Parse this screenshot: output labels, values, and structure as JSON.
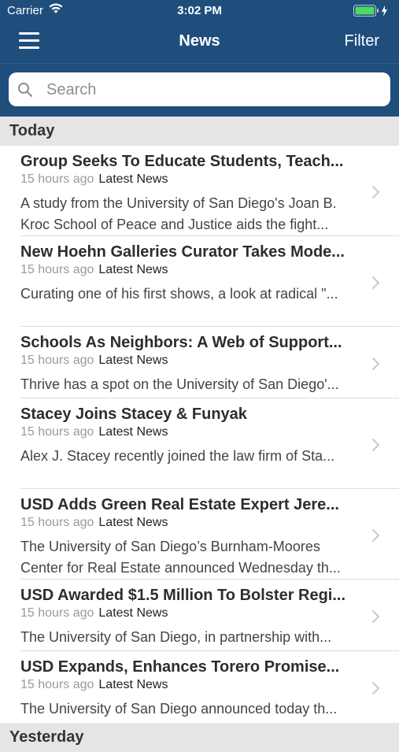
{
  "status": {
    "carrier": "Carrier",
    "time": "3:02 PM"
  },
  "nav": {
    "title": "News",
    "filter": "Filter"
  },
  "search": {
    "placeholder": "Search"
  },
  "sections": [
    {
      "header": "Today",
      "items": [
        {
          "title": "Group Seeks To Educate Students, Teach...",
          "time": "15 hours ago",
          "category": "Latest News",
          "summary": "A study from the University of San Diego's Joan B. Kroc School of Peace and Justice aids the fight..."
        },
        {
          "title": "New Hoehn Galleries Curator Takes Mode...",
          "time": "15 hours ago",
          "category": "Latest News",
          "summary": "Curating one of his first shows, a look at radical \"..."
        },
        {
          "title": "Schools As Neighbors: A Web of Support...",
          "time": "15 hours ago",
          "category": "Latest News",
          "summary": "Thrive has a spot on the University of San Diego'..."
        },
        {
          "title": "Stacey Joins Stacey & Funyak",
          "time": "15 hours ago",
          "category": "Latest News",
          "summary": "Alex J. Stacey recently joined the law firm of Sta..."
        },
        {
          "title": "USD Adds Green Real Estate Expert Jere...",
          "time": "15 hours ago",
          "category": "Latest News",
          "summary": "The University of San Diego’s Burnham-Moores Center for Real Estate announced Wednesday th..."
        },
        {
          "title": "USD Awarded $1.5 Million To Bolster Regi...",
          "time": "15 hours ago",
          "category": "Latest News",
          "summary": "The University of San Diego, in partnership with..."
        },
        {
          "title": "USD Expands, Enhances Torero Promise...",
          "time": "15 hours ago",
          "category": "Latest News",
          "summary": "The University of San Diego announced today th..."
        }
      ]
    },
    {
      "header": "Yesterday",
      "items": []
    }
  ],
  "colors": {
    "nav_bg": "#1f4e7d",
    "section_bg": "#e5e5e5",
    "battery": "#4cd964"
  }
}
